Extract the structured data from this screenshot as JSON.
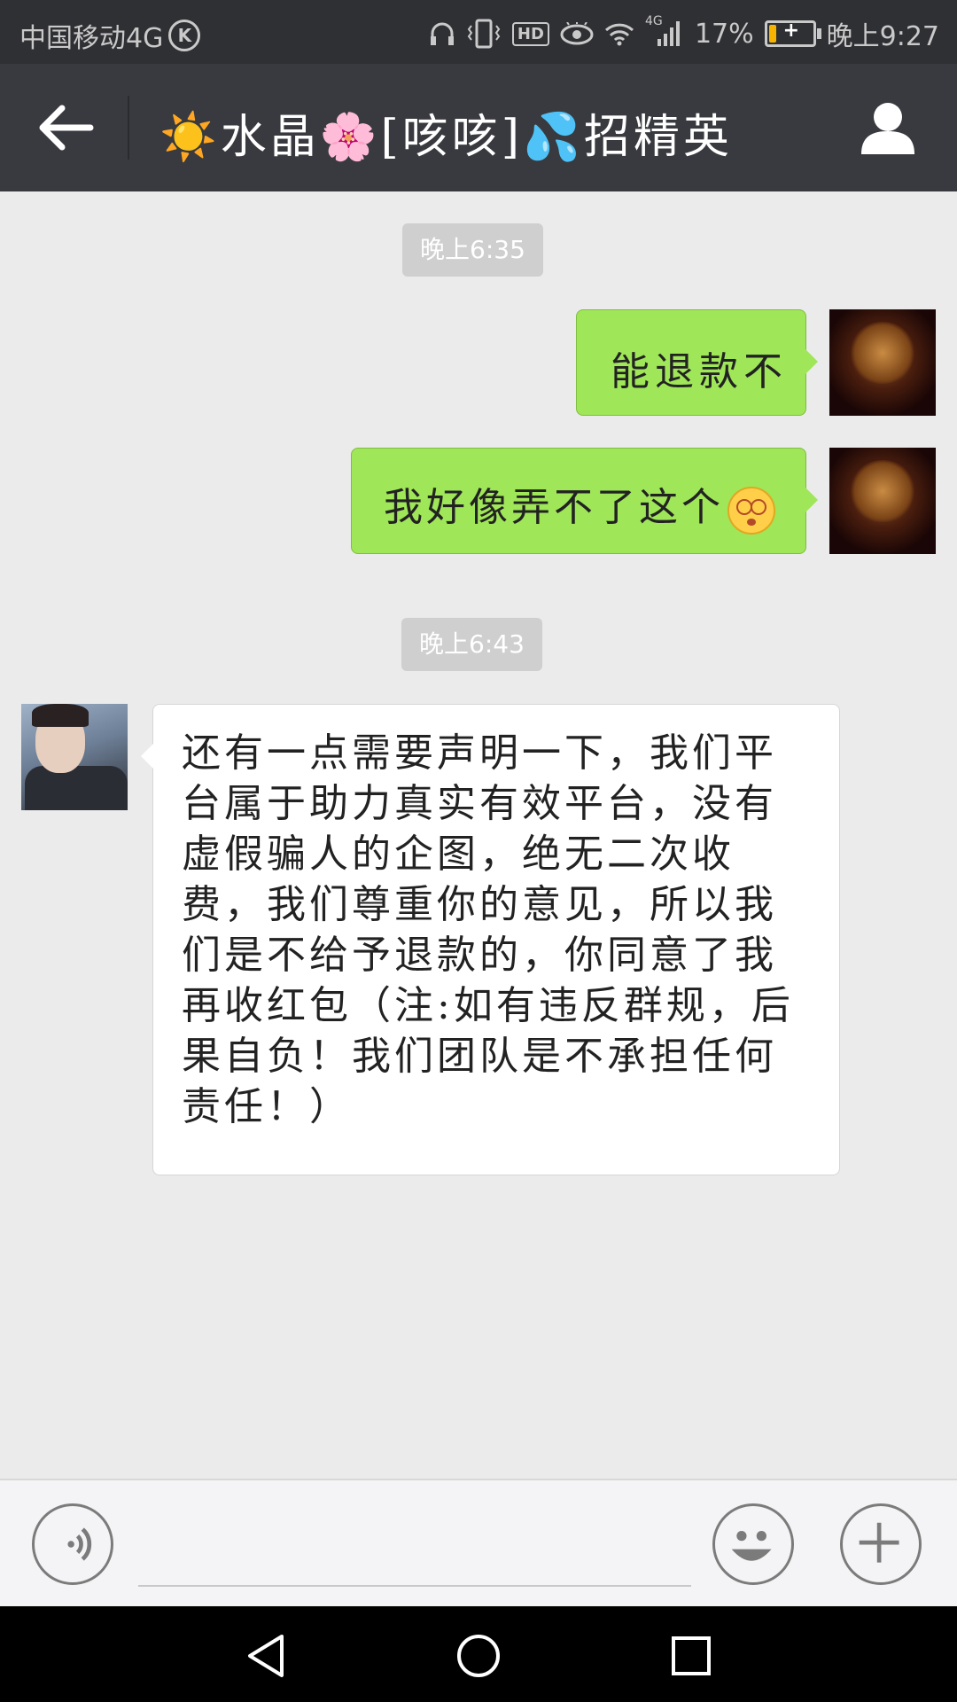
{
  "status_bar": {
    "carrier": "中国移动4G",
    "carrier_badge": "K",
    "hd_label": "HD",
    "network_label": "4G",
    "battery_percent": "17%",
    "battery_level": 0.17,
    "time": "晚上9:27"
  },
  "header": {
    "title": "☀️水晶🌸[咳咳]💦招精英",
    "back_icon": "back-arrow-icon",
    "profile_icon": "person-icon"
  },
  "messages": [
    {
      "type": "timestamp",
      "text": "晚上6:35"
    },
    {
      "type": "outgoing",
      "text": "能退款不"
    },
    {
      "type": "outgoing",
      "text": "我好像弄不了这个",
      "emoji": "dizzy-face-emoji"
    },
    {
      "type": "timestamp",
      "text": "晚上6:43"
    },
    {
      "type": "incoming",
      "text": "还有一点需要声明一下，我们平台属于助力真实有效平台，没有虚假骗人的企图，绝无二次收费，我们尊重你的意见，所以我们是不给予退款的，你同意了我再收红包（注:如有违反群规，后果自负！我们团队是不承担任何责任！）"
    }
  ],
  "input_bar": {
    "voice_icon": "voice-icon",
    "emoji_icon": "smiley-icon",
    "plus_icon": "plus-icon"
  },
  "colors": {
    "status_bar_bg": "#2f3034",
    "title_bar_bg": "#393a3f",
    "chat_bg": "#ebebeb",
    "outgoing_bubble": "#9fe658",
    "incoming_bubble": "#ffffff",
    "timestamp_bg": "#cfcfcf",
    "battery_fill": "#f6b300"
  }
}
